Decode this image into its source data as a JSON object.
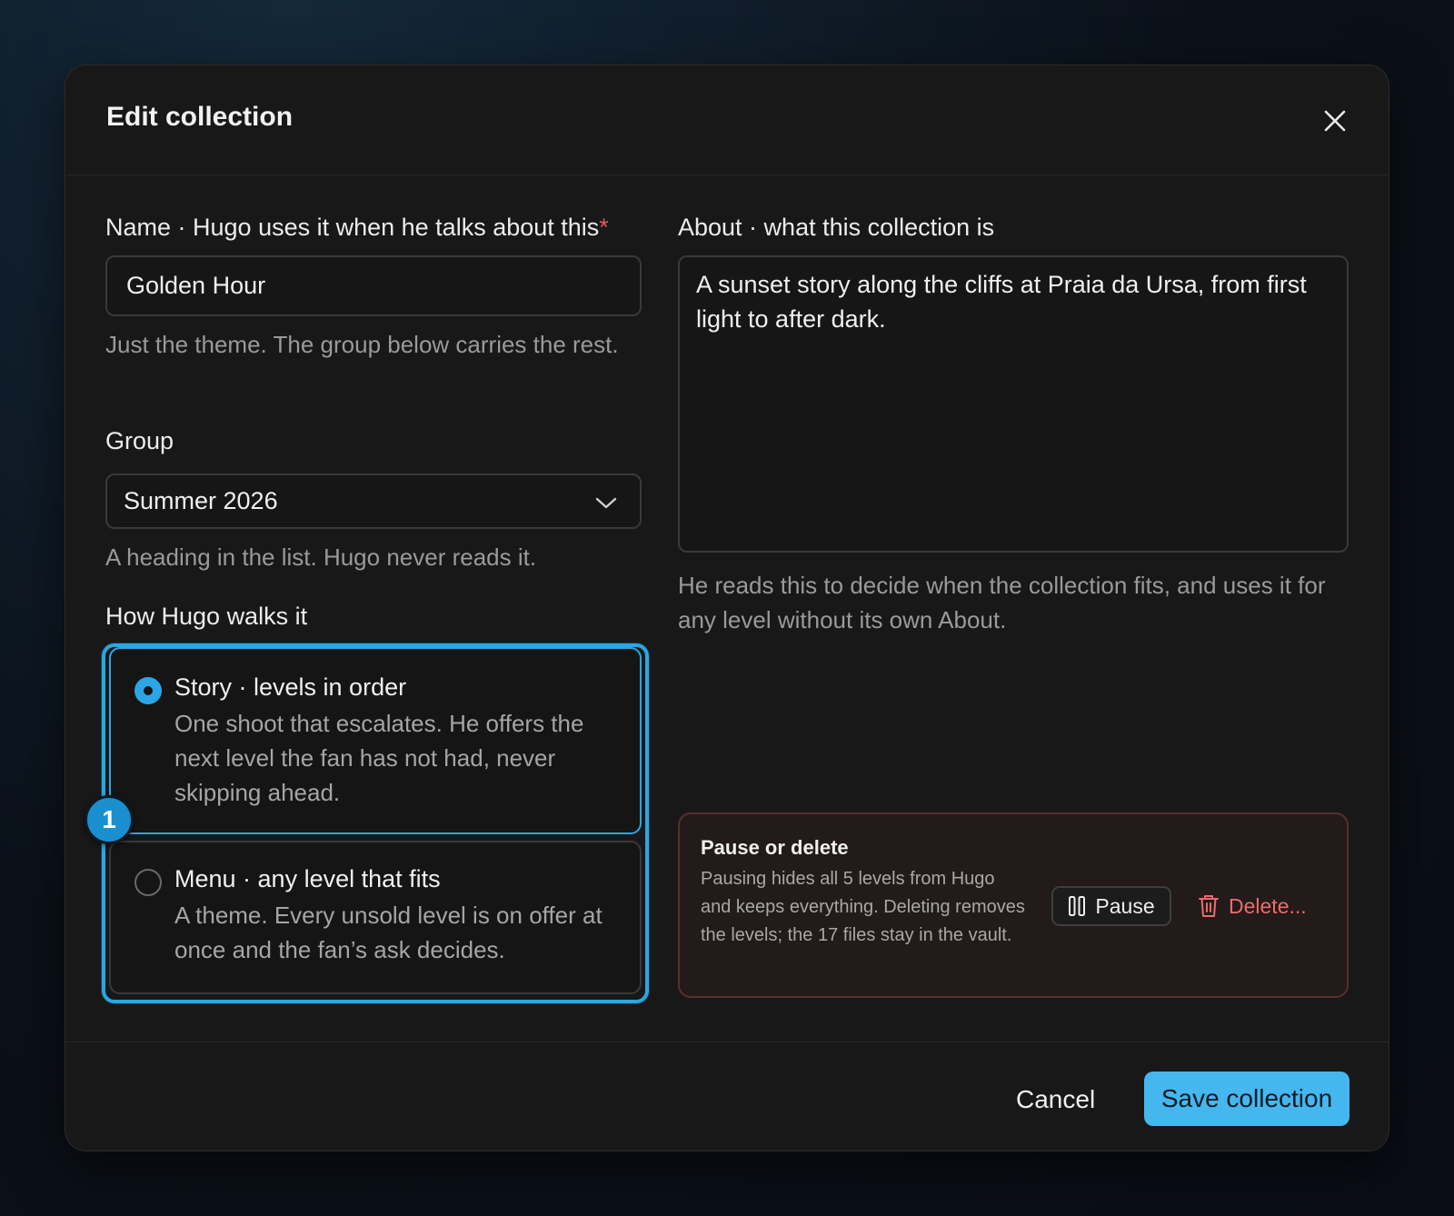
{
  "dialog": {
    "title": "Edit collection"
  },
  "name_field": {
    "label": "Name · Hugo uses it when he talks about this",
    "required_mark": "*",
    "value": "Golden Hour",
    "hint": "Just the theme. The group below carries the rest."
  },
  "group_field": {
    "label": "Group",
    "selected": "Summer 2026",
    "hint": "A heading in the list. Hugo never reads it."
  },
  "walk_mode": {
    "label": "How Hugo walks it",
    "step_badge": "1",
    "options": [
      {
        "title": "Story · levels in order",
        "description": "One shoot that escalates. He offers the next level the fan has not had, never skipping ahead.",
        "selected": true
      },
      {
        "title": "Menu · any level that fits",
        "description": "A theme. Every unsold level is on offer at once and the fan’s ask decides.",
        "selected": false
      }
    ]
  },
  "about_field": {
    "label": "About · what this collection is",
    "value": "A sunset story along the cliffs at Praia da Ursa, from first light to after dark.",
    "hint": "He reads this to decide when the collection fits, and uses it for any level without its own About."
  },
  "danger_zone": {
    "title": "Pause or delete",
    "description": "Pausing hides all 5 levels from Hugo and keeps everything. Deleting removes the levels; the 17 files stay in the vault.",
    "pause_label": "Pause",
    "delete_label": "Delete..."
  },
  "footer": {
    "cancel_label": "Cancel",
    "save_label": "Save collection"
  },
  "colors": {
    "accent": "#2aa6e4",
    "primary_button": "#45b7ee",
    "danger": "#ef6b6b",
    "required": "#e05a5a"
  },
  "icons": [
    "close-icon",
    "chevron-down-icon",
    "pause-icon",
    "trash-icon"
  ]
}
